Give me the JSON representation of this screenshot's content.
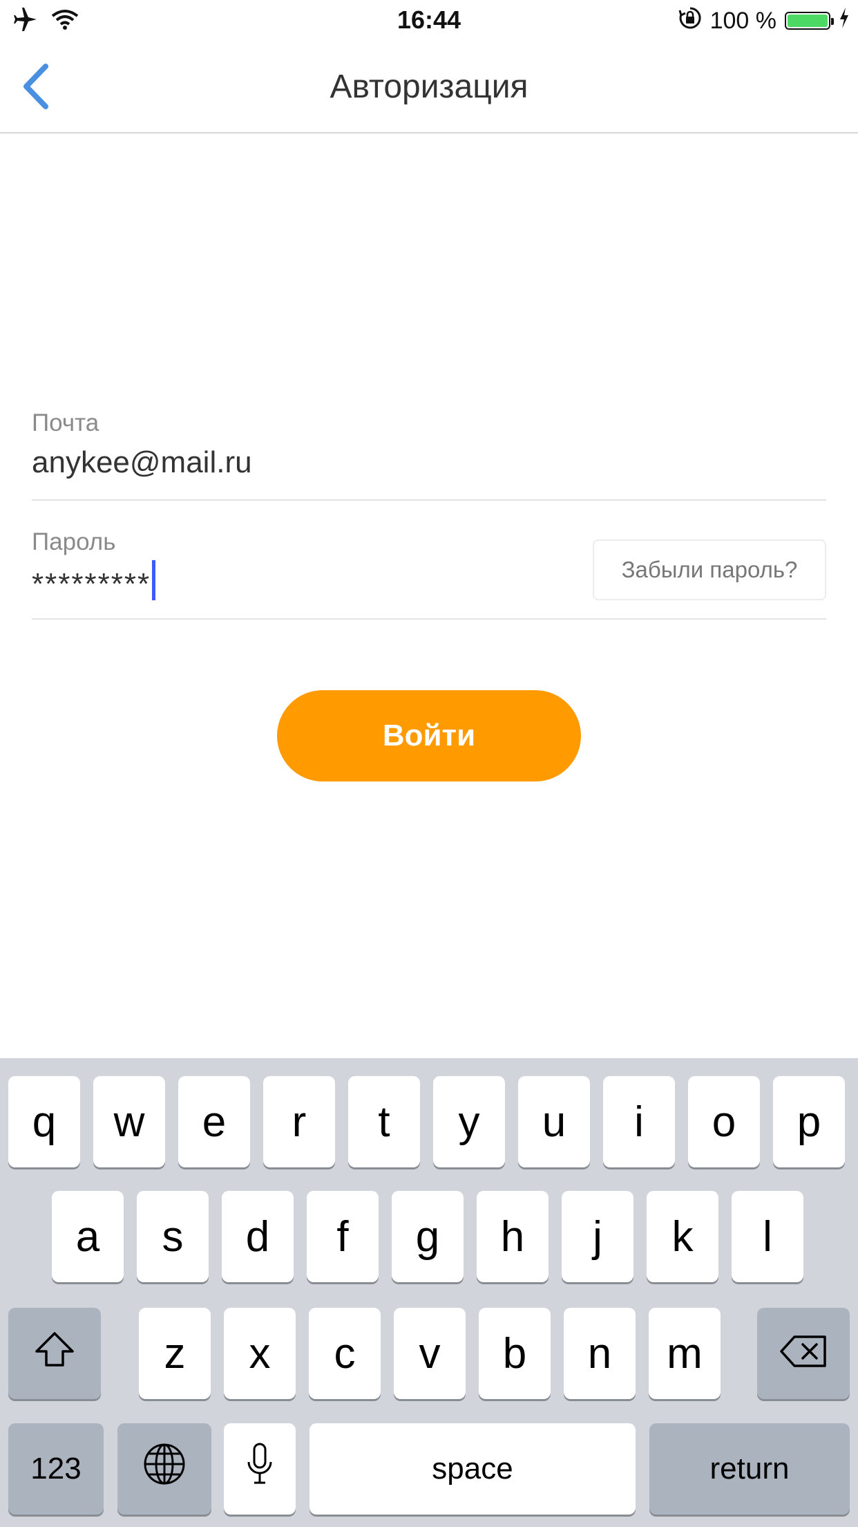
{
  "status_bar": {
    "time": "16:44",
    "battery_percent": "100 %",
    "battery_level": 1.0,
    "battery_color": "#4cd964"
  },
  "nav": {
    "title": "Авторизация",
    "back_icon": "chevron-left-icon",
    "accent": "#4a90e2"
  },
  "form": {
    "email": {
      "label": "Почта",
      "value": "anykee@mail.ru"
    },
    "password": {
      "label": "Пароль",
      "value": "*********",
      "forgot_label": "Забыли пароль?"
    },
    "submit_label": "Войти",
    "submit_color": "#ff9a00"
  },
  "keyboard": {
    "row1": [
      "q",
      "w",
      "e",
      "r",
      "t",
      "y",
      "u",
      "i",
      "o",
      "p"
    ],
    "row2": [
      "a",
      "s",
      "d",
      "f",
      "g",
      "h",
      "j",
      "k",
      "l"
    ],
    "row3": [
      "z",
      "x",
      "c",
      "v",
      "b",
      "n",
      "m"
    ],
    "numbers_label": "123",
    "space_label": "space",
    "return_label": "return"
  }
}
